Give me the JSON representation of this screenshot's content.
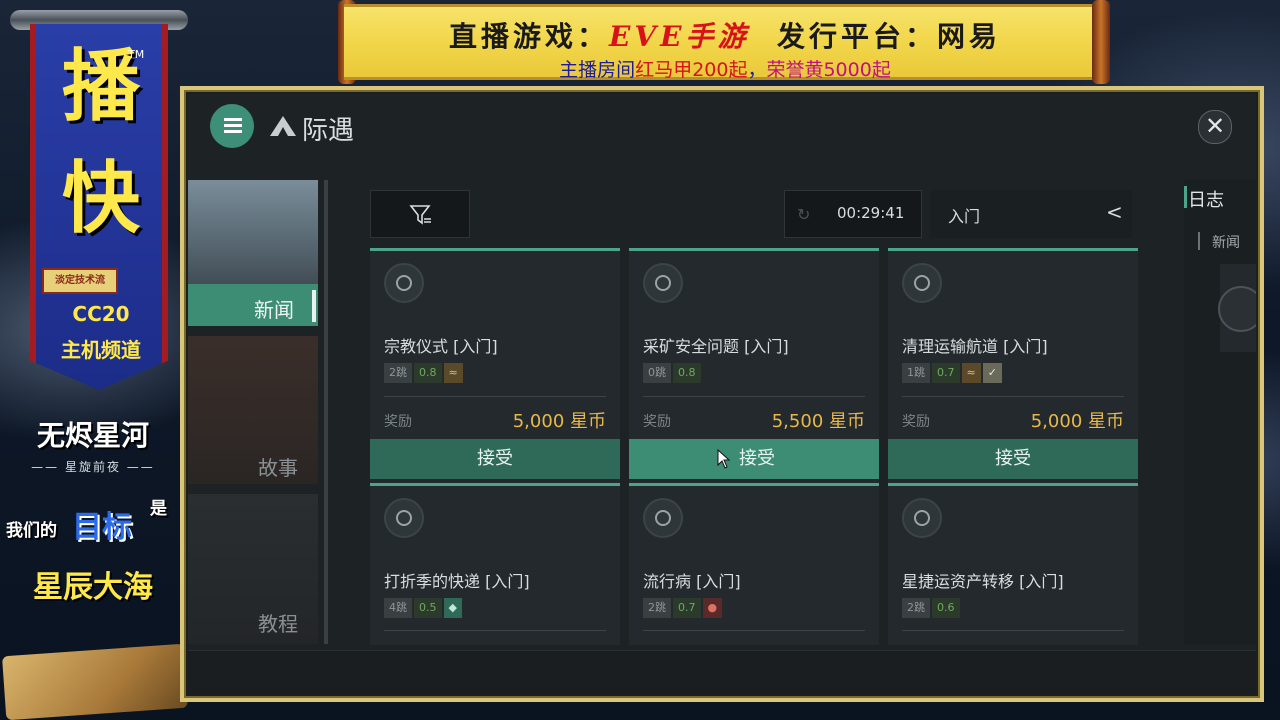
{
  "stream_banner": {
    "line1_prefix": "直播游戏：",
    "line1_game": "EVE手游",
    "line1_suffix": "发行平台：网易",
    "line2_a": "主播房间",
    "line2_b": "红马甲200起",
    "line2_c": "，",
    "line2_d": "荣誉黄5000起"
  },
  "left_banner": {
    "char1": "播",
    "char2": "快",
    "tm": "TM",
    "stamp": "淡定技术流",
    "cc": "CC20",
    "channel": "主机频道"
  },
  "left_text": {
    "line1": "无烬星河",
    "line2": "—— 星旋前夜 ——",
    "line3a": "我们的",
    "line3b": "目标",
    "line3c": "是",
    "line4": "星辰大海"
  },
  "window": {
    "title": "际遇",
    "close_glyph": "✕"
  },
  "sidebar": {
    "items": [
      {
        "label": "新闻",
        "active": true
      },
      {
        "label": "故事",
        "active": false
      },
      {
        "label": "教程",
        "active": false
      }
    ]
  },
  "toolbar": {
    "timer": "00:29:41",
    "level": "入门",
    "chevron": "<"
  },
  "missions": [
    {
      "title": "宗教仪式 [入门]",
      "jumps": "2跳",
      "security": "0.8",
      "icons": [
        "faction-icon"
      ],
      "reward_label": "奖励",
      "reward": "5,000 星币",
      "accept": "接受"
    },
    {
      "title": "采矿安全问题 [入门]",
      "jumps": "0跳",
      "security": "0.8",
      "icons": [],
      "reward_label": "奖励",
      "reward": "5,500 星币",
      "accept": "接受"
    },
    {
      "title": "清理运输航道 [入门]",
      "jumps": "1跳",
      "security": "0.7",
      "icons": [
        "faction-icon",
        "check-icon"
      ],
      "reward_label": "奖励",
      "reward": "5,000 星币",
      "accept": "接受"
    },
    {
      "title": "打折季的快递 [入门]",
      "jumps": "4跳",
      "security": "0.5",
      "icons": [
        "shield-icon"
      ]
    },
    {
      "title": "流行病 [入门]",
      "jumps": "2跳",
      "security": "0.7",
      "icons": [
        "virus-icon"
      ]
    },
    {
      "title": "星捷运资产转移 [入门]",
      "jumps": "2跳",
      "security": "0.6",
      "icons": []
    }
  ],
  "log_panel": {
    "title": "日志",
    "tab": "新闻"
  },
  "colors": {
    "accent": "#3d8c74",
    "reward": "#e8b84a",
    "frame": "#d8c77a"
  }
}
